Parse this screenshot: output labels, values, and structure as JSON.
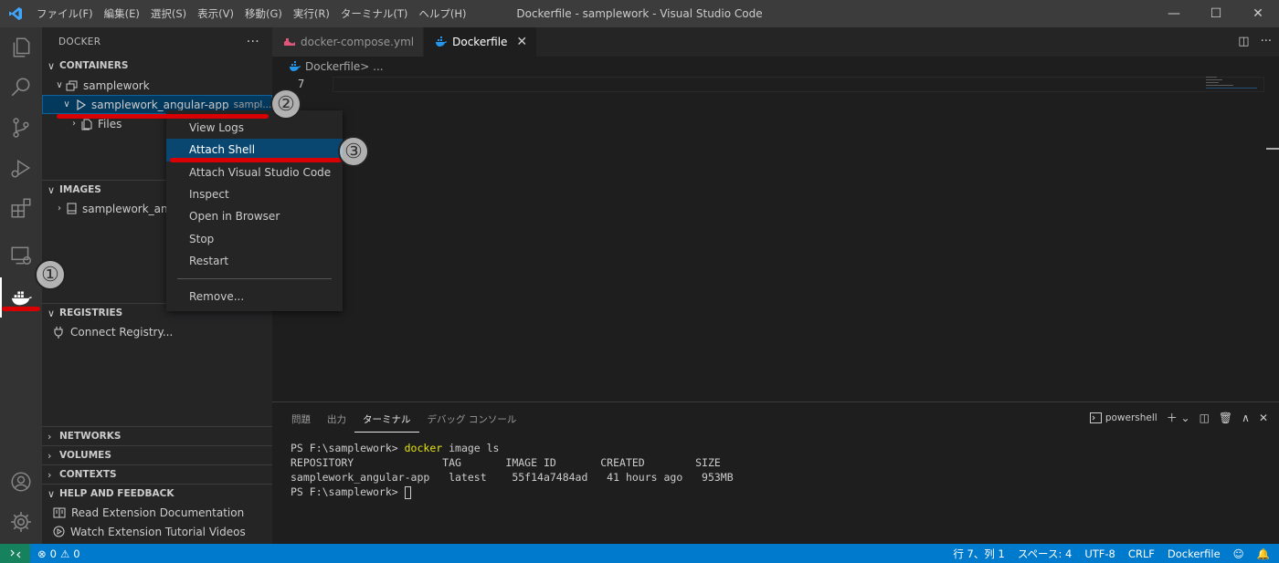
{
  "titlebar": {
    "menu": [
      "ファイル(F)",
      "編集(E)",
      "選択(S)",
      "表示(V)",
      "移動(G)",
      "実行(R)",
      "ターミナル(T)",
      "ヘルプ(H)"
    ],
    "title": "Dockerfile - samplework - Visual Studio Code",
    "controls": [
      "—",
      "☐",
      "✕"
    ]
  },
  "sidebar": {
    "header": "DOCKER",
    "more": "···",
    "containers": {
      "title": "CONTAINERS",
      "group": "samplework",
      "container": "samplework_angular-app",
      "container_desc": "sampl...",
      "child": "Files"
    },
    "images": {
      "title": "IMAGES",
      "item": "samplework_an"
    },
    "registries": {
      "title": "REGISTRIES",
      "item": "Connect Registry..."
    },
    "networks": "NETWORKS",
    "volumes": "VOLUMES",
    "contexts": "CONTEXTS",
    "help": {
      "title": "HELP AND FEEDBACK",
      "items": [
        "Read Extension Documentation",
        "Watch Extension Tutorial Videos"
      ]
    }
  },
  "context_menu": {
    "items": [
      "View Logs",
      "Attach Shell",
      "Attach Visual Studio Code",
      "Inspect",
      "Open in Browser",
      "Stop",
      "Restart"
    ],
    "remove": "Remove...",
    "highlighted": "Attach Shell"
  },
  "tabs": [
    {
      "label": "docker-compose.yml",
      "active": false
    },
    {
      "label": "Dockerfile",
      "active": true
    }
  ],
  "breadcrumb": {
    "file": "Dockerfile",
    "rest": " > ..."
  },
  "editor": {
    "line_number": "7"
  },
  "panel": {
    "tabs": [
      "問題",
      "出力",
      "ターミナル",
      "デバッグ コンソール"
    ],
    "active_tab": "ターミナル",
    "shell": "powershell",
    "terminal": {
      "line1_prompt": "PS F:\\samplework> ",
      "line1_cmd": "docker",
      "line1_args": " image ls",
      "header": "REPOSITORY              TAG       IMAGE ID       CREATED        SIZE",
      "row": "samplework_angular-app   latest    55f14a7484ad   41 hours ago   953MB",
      "line4_prompt": "PS F:\\samplework> "
    }
  },
  "statusbar": {
    "errors": "0",
    "warnings": "0",
    "position": "行 7、列 1",
    "spaces": "スペース: 4",
    "encoding": "UTF-8",
    "eol": "CRLF",
    "language": "Dockerfile"
  },
  "annotations": [
    "①",
    "②",
    "③"
  ],
  "colors": {
    "statusbar": "#007acc",
    "remote": "#16825d",
    "highlight": "#094771",
    "annotation_line": "#d80000",
    "docker_blue": "#2496ed"
  }
}
